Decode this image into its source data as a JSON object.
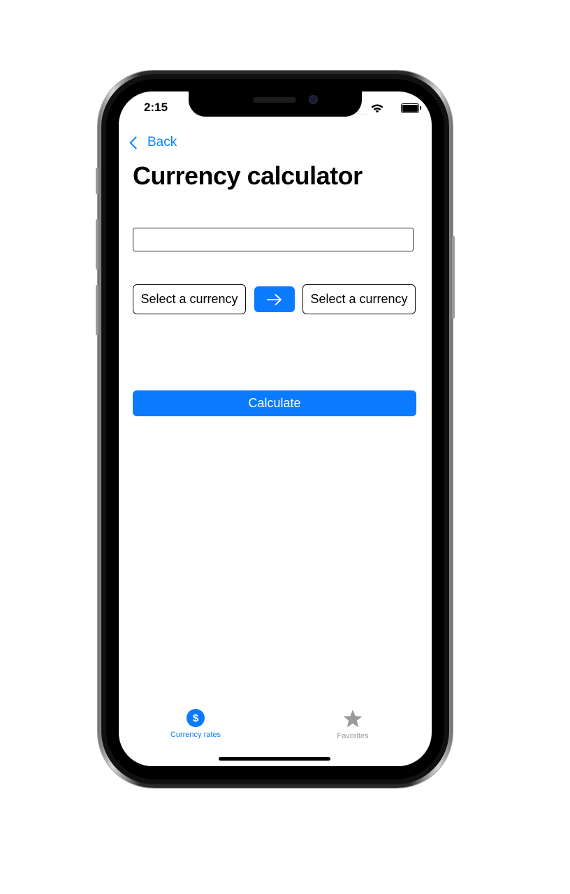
{
  "status_bar": {
    "time": "2:15",
    "signal": "....",
    "icons": [
      "wifi-icon",
      "battery-icon"
    ]
  },
  "nav": {
    "back_label": "Back"
  },
  "page": {
    "title": "Currency calculator"
  },
  "converter": {
    "amount_value": "",
    "amount_placeholder": "",
    "from_label": "Select a currency",
    "to_label": "Select a currency",
    "swap_icon": "arrow-right-icon",
    "calculate_label": "Calculate"
  },
  "tab_bar": {
    "items": [
      {
        "label": "Currency rates",
        "icon": "dollar-icon",
        "selected": true
      },
      {
        "label": "Favorites",
        "icon": "star-icon",
        "selected": false
      }
    ]
  },
  "colors": {
    "accent": "#0A7AFF",
    "tab_inactive": "#999999",
    "text": "#000000"
  }
}
